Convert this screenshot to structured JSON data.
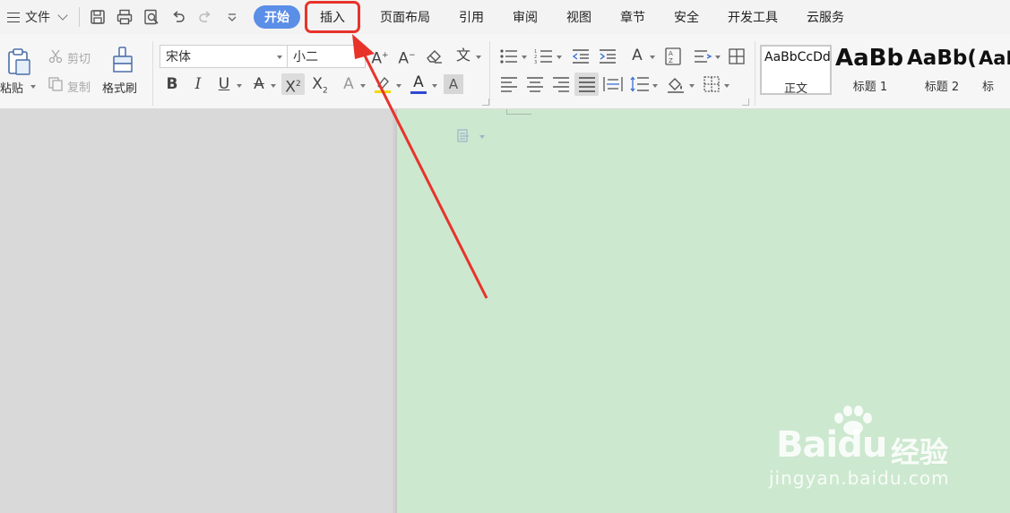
{
  "menubar": {
    "file_label": "文件",
    "tabs": [
      {
        "label": "开始"
      },
      {
        "label": "插入"
      },
      {
        "label": "页面布局"
      },
      {
        "label": "引用"
      },
      {
        "label": "审阅"
      },
      {
        "label": "视图"
      },
      {
        "label": "章节"
      },
      {
        "label": "安全"
      },
      {
        "label": "开发工具"
      },
      {
        "label": "云服务"
      }
    ],
    "quick_access_icons": [
      "save-icon",
      "print-icon",
      "print-preview-icon",
      "undo-icon",
      "redo-icon",
      "customize-icon"
    ]
  },
  "ribbon": {
    "clipboard": {
      "paste_label": "粘贴",
      "cut_label": "剪切",
      "copy_label": "复制",
      "format_painter_label": "格式刷"
    },
    "font": {
      "font_name": "宋体",
      "font_size": "小二"
    },
    "styles": [
      {
        "sample": "AaBbCcDd",
        "name": "正文"
      },
      {
        "sample": "AaBb",
        "name": "标题 1"
      },
      {
        "sample": "AaBb(",
        "name": "标题 2"
      },
      {
        "sample": "AaI",
        "name": "标"
      }
    ]
  },
  "annotation": {
    "color": "#e8332a",
    "highlighted_tab": "插入"
  },
  "watermark": {
    "brand": "Bai",
    "brand2": "du",
    "cn": "经验",
    "url": "jingyan.baidu.com"
  },
  "colors": {
    "active_tab": "#5b8ee6",
    "document_bg": "#cce8cf",
    "canvas_bg": "#d9d9d9"
  }
}
